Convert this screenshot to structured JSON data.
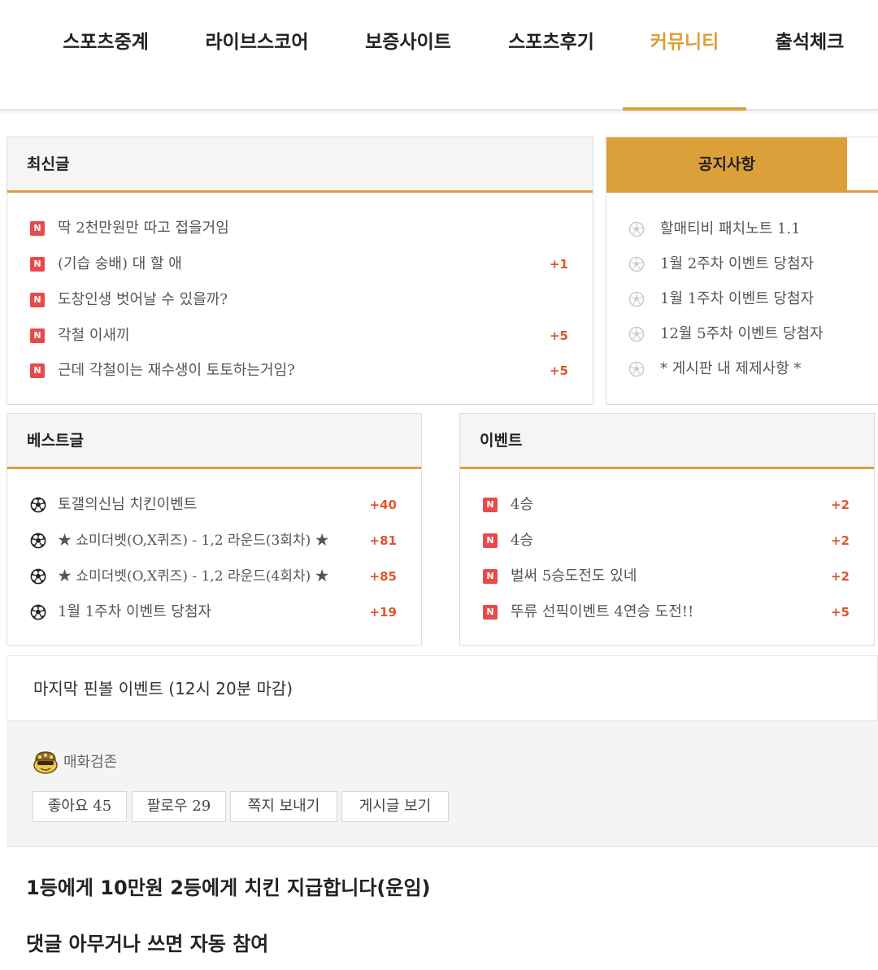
{
  "nav": {
    "items": [
      {
        "label": "스포츠중계"
      },
      {
        "label": "라이브스코어"
      },
      {
        "label": "보증사이트"
      },
      {
        "label": "스포츠후기"
      },
      {
        "label": "커뮤니티"
      },
      {
        "label": "출석체크"
      }
    ],
    "active_color": "#dca03a"
  },
  "latest": {
    "title": "최신글",
    "items": [
      {
        "text": "딱 2천만원만 따고 접을거임",
        "count": ""
      },
      {
        "text": "(기습 숭배) 대 할 애",
        "count": "+1"
      },
      {
        "text": "도창인생 벗어날 수 있을까?",
        "count": ""
      },
      {
        "text": "각철 이새끼",
        "count": "+5"
      },
      {
        "text": "근데 각철이는 재수생이 토토하는거임?",
        "count": "+5"
      }
    ]
  },
  "notice": {
    "title": "공지사항",
    "items": [
      {
        "text": "할매티비 패치노트 1.1"
      },
      {
        "text": "1월 2주차 이벤트 당첨자"
      },
      {
        "text": "1월 1주차 이벤트 당첨자"
      },
      {
        "text": "12월 5주차 이벤트 당첨자"
      },
      {
        "text": "* 게시판 내 제제사항 *"
      }
    ]
  },
  "best": {
    "title": "베스트글",
    "items": [
      {
        "text": "토갤의신님 치킨이벤트",
        "count": "+40"
      },
      {
        "text": "★ 쇼미더벳(O,X퀴즈) - 1,2 라운드(3회차) ★",
        "count": "+81"
      },
      {
        "text": "★ 쇼미더벳(O,X퀴즈) - 1,2 라운드(4회차) ★",
        "count": "+85"
      },
      {
        "text": "1월 1주차 이벤트 당첨자",
        "count": "+19"
      }
    ]
  },
  "event": {
    "title": "이벤트",
    "items": [
      {
        "text": "4승",
        "count": "+2"
      },
      {
        "text": "4승",
        "count": "+2"
      },
      {
        "text": "벌써 5승도전도 있네",
        "count": "+2"
      },
      {
        "text": "뚜류 선픽이벤트 4연승 도전!!",
        "count": "+5"
      }
    ]
  },
  "post": {
    "title": "마지막 핀볼 이벤트 (12시 20분 마감)",
    "author": "매화검존",
    "buttons": {
      "like": "좋아요 45",
      "follow": "팔로우 29",
      "message": "쪽지 보내기",
      "posts": "게시글 보기"
    },
    "body": [
      "1등에게 10만원 2등에게 치킨 지급합니다(운임)",
      "댓글 아무거나 쓰면 자동 참여"
    ]
  },
  "icons": {
    "new": "new-badge-icon",
    "soccer": "soccer-ball-icon",
    "avatar": "avatar-icon"
  },
  "colors": {
    "accent": "#dca03a",
    "count": "#e0552f",
    "new_badge": "#e84a4a"
  }
}
